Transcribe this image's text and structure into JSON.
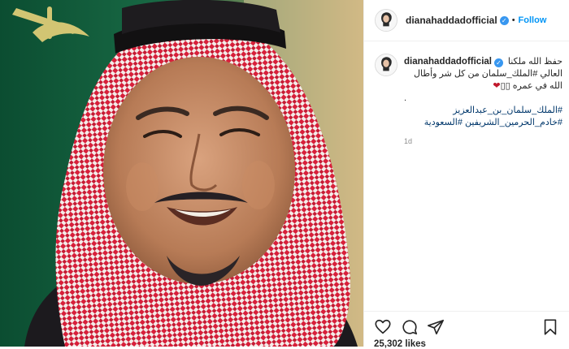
{
  "post": {
    "username": "dianahaddadofficial",
    "follow_label": "Follow",
    "verified_icon": "verified-badge-icon",
    "caption_head": "حفظ الله ملكنا",
    "caption_line2": "العالي #الملك_سلمان من كل شر وأطال",
    "caption_line3": "الله في عمره",
    "caption_line3_heart": "❤",
    "caption_line3_boxes": "▯▯",
    "caption_dot": ".",
    "hashtag1": "#الملك_سلمان_بن_عبدالعزيز",
    "hashtag2": "#خادم_الحرمين_الشريفين",
    "hashtag3": "#السعودية",
    "time_ago": "1d",
    "likes": "25,302 likes"
  },
  "icons": {
    "like": "heart-outline-icon",
    "comment": "comment-icon",
    "share": "paper-plane-icon",
    "save": "bookmark-icon"
  },
  "colors": {
    "accent": "#0095f6",
    "hashtag": "#00376b",
    "muted": "#8e8e8e",
    "border": "#efefef",
    "keffiyeh_red": "#d81f3a",
    "flag_green": "#0f5a38"
  }
}
